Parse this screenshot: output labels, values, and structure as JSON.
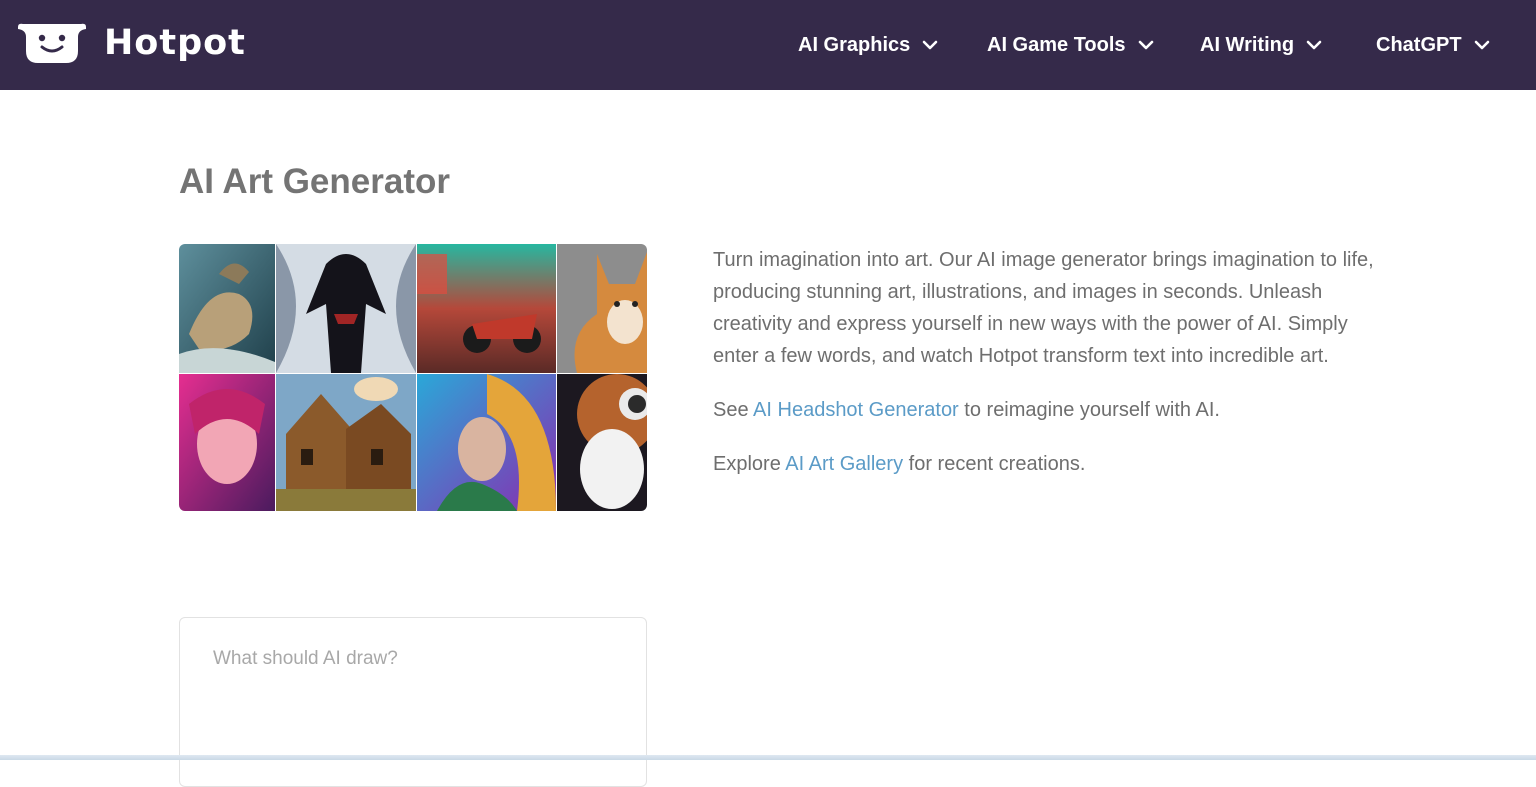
{
  "header": {
    "brand_name": "Hotpot",
    "brand_icon": "smiling-pot-logo-icon",
    "background_color": "#352a4a",
    "nav_items": [
      {
        "label": "AI Graphics",
        "icon": "chevron-down-icon"
      },
      {
        "label": "AI Game Tools",
        "icon": "chevron-down-icon"
      },
      {
        "label": "AI Writing",
        "icon": "chevron-down-icon"
      },
      {
        "label": "ChatGPT",
        "icon": "chevron-down-icon"
      }
    ]
  },
  "main": {
    "title": "AI Art Generator",
    "gallery": {
      "tiles": [
        "dragon",
        "black-symbiote-hero",
        "neon-motorcycle-street",
        "shiba-puppy",
        "neon-girl-portrait",
        "medieval-house",
        "feathered-woman",
        "astronaut-and-planet"
      ]
    },
    "description": {
      "intro": "Turn imagination into art. Our AI image generator brings imagination to life, producing stunning art, illustrations, and images in seconds. Unleash creativity and express yourself in new ways with the power of AI. Simply enter a few words, and watch Hotpot transform text into incredible art.",
      "headshot_prefix": "See ",
      "headshot_link": "AI Headshot Generator",
      "headshot_suffix": " to reimagine yourself with AI.",
      "gallery_prefix": "Explore ",
      "gallery_link": "AI Art Gallery",
      "gallery_suffix": " for recent creations."
    },
    "prompt": {
      "placeholder": "What should AI draw?",
      "value": ""
    }
  },
  "colors": {
    "link": "#5b9bc7",
    "title": "#747474",
    "body_text": "#6e6e6e"
  }
}
